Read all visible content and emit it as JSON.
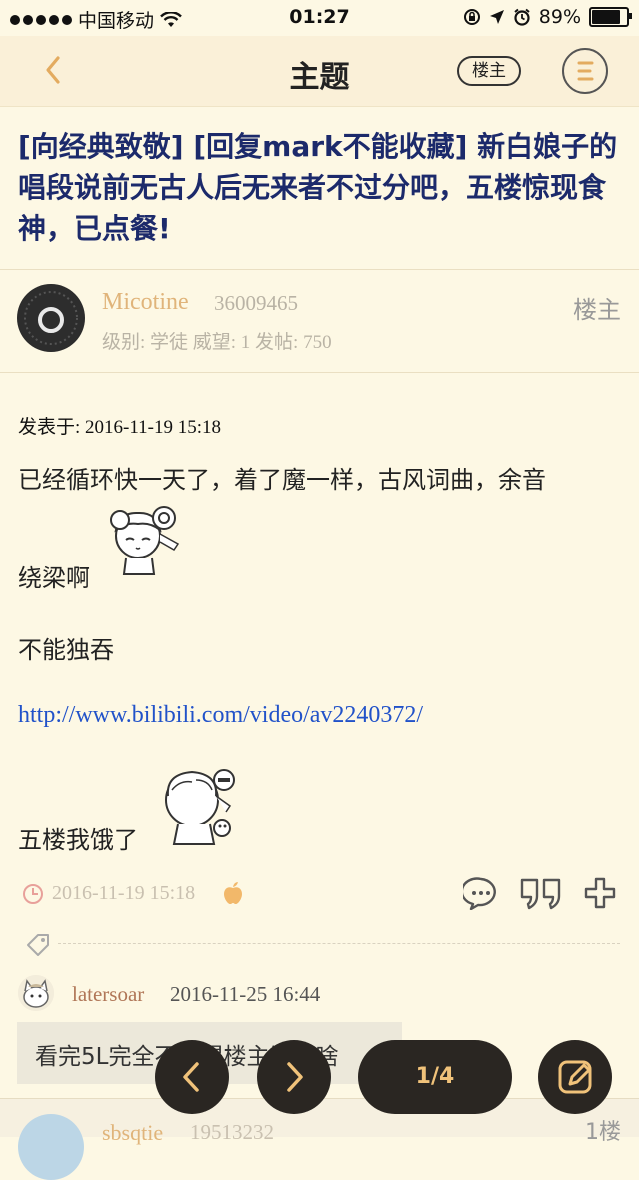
{
  "status_bar": {
    "carrier": "中国移动",
    "time": "01:27",
    "battery": "89%"
  },
  "nav": {
    "title": "主题",
    "owner_button": "楼主"
  },
  "thread": {
    "title": "[向经典致敬] [回复mark不能收藏] 新白娘子的唱段说前无古人后无来者不过分吧，五楼惊现食神，已点餐!"
  },
  "author": {
    "name": "Micotine",
    "uid": "36009465",
    "meta": "级别: 学徒  威望: 1  发帖: 750",
    "role": "楼主"
  },
  "post": {
    "posted_at": "发表于:  2016-11-19 15:18",
    "line1": "已经循环快一天了，着了魔一样，古风词曲，余音",
    "line2": "绕梁啊",
    "line3": "不能独吞",
    "link": "http://www.bilibili.com/video/av2240372/",
    "line4": "五楼我饿了",
    "footer_time": "2016-11-19 15:18"
  },
  "comment": {
    "user": "latersoar",
    "time": "2016-11-25 16:44",
    "text": "看完5L完全不记得楼主说了啥"
  },
  "next_post": {
    "name": "sbsqtie",
    "uid": "19513232",
    "floor": "1楼"
  },
  "pager": {
    "label": "1/4"
  },
  "colors": {
    "background": "#fdf8e4",
    "accent": "#f0c27a",
    "title": "#1c2a6b",
    "link": "#2152c9"
  }
}
